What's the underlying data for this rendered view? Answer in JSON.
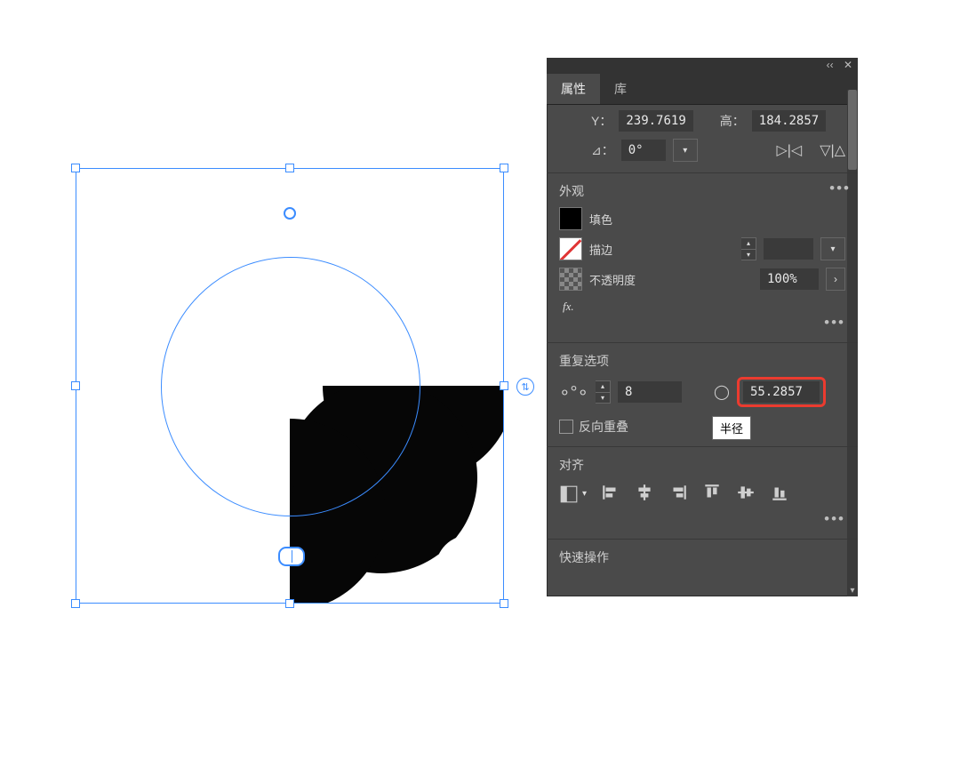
{
  "tabs": {
    "properties": "属性",
    "library": "库"
  },
  "transform": {
    "y_label": "Y：",
    "y_value": "239.7619",
    "h_label": "高：",
    "h_value": "184.2857",
    "angle_glyph": "⊿：",
    "angle_value": "0°"
  },
  "appearance": {
    "section_title": "外观",
    "fill_label": "填色",
    "stroke_label": "描边",
    "opacity_label": "不透明度",
    "opacity_value": "100%",
    "fx_label": "fx.",
    "stroke_weight_value": ""
  },
  "repeat": {
    "section_title": "重复选项",
    "count_value": "8",
    "radius_value": "55.2857",
    "radius_tooltip": "半径",
    "reverse_overlap_label": "反向重叠"
  },
  "align": {
    "section_title": "对齐"
  },
  "quick": {
    "section_title": "快速操作"
  },
  "ellipsis": "•••",
  "title_strip": {
    "collapse": "‹‹",
    "close": "✕"
  },
  "rotator_glyph": "⇅"
}
